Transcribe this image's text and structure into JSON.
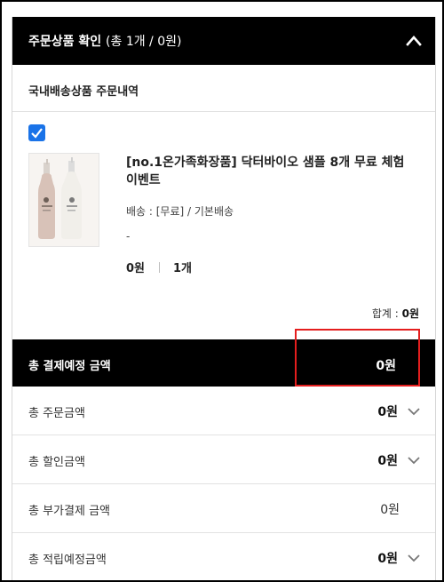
{
  "order_summary": {
    "title": "주문상품 확인",
    "count_text": "(총 1개 / 0원)"
  },
  "section": {
    "title": "국내배송상품 주문내역"
  },
  "product": {
    "checked": true,
    "name": "[no.1온가족화장품] 닥터바이오 샘플 8개 무료 체험 이벤트",
    "shipping": "배송 : [무료] / 기본배송",
    "option": "-",
    "price": "0원",
    "quantity": "1개",
    "image_icon": "product-bottles-image"
  },
  "subtotal": {
    "label": "합계 : ",
    "value": "0원"
  },
  "totals": {
    "header_label": "총 결제예정 금액",
    "header_value": "0원",
    "rows": [
      {
        "label": "총 주문금액",
        "value": "0원",
        "expandable": true
      },
      {
        "label": "총 할인금액",
        "value": "0원",
        "expandable": true
      },
      {
        "label": "총 부가결제 금액",
        "value": "0원",
        "expandable": false
      },
      {
        "label": "총 적립예정금액",
        "value": "0원",
        "expandable": true
      }
    ]
  },
  "colors": {
    "header_bg": "#000000",
    "checkbox": "#1a73e8",
    "highlight_box": "#e41e1e",
    "divider": "#e2e2e2"
  }
}
